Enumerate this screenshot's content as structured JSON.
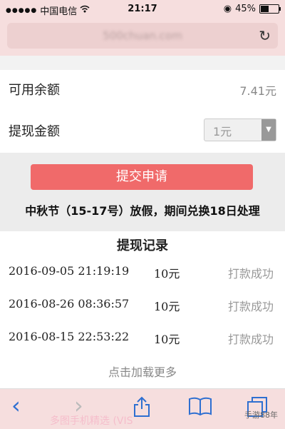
{
  "status": {
    "signal": "●●●●●",
    "carrier": "中国电信",
    "wifi_icon": "wifi-icon",
    "time": "21:17",
    "battery_pct": "45%",
    "battery_fill": 0.45
  },
  "browser": {
    "url": "500chuan.com"
  },
  "account": {
    "balance_label": "可用余额",
    "balance_value": "7.41元",
    "withdraw_label": "提现金额",
    "withdraw_selected": "1元"
  },
  "actions": {
    "submit_label": "提交申请",
    "notice": "中秋节（15-17号）放假，期间兑换18日处理"
  },
  "records": {
    "title": "提现记录",
    "rows": [
      {
        "date": "2016-09-05 21:19:19",
        "amount": "10元",
        "status": "打款成功"
      },
      {
        "date": "2016-08-26 08:36:57",
        "amount": "10元",
        "status": "打款成功"
      },
      {
        "date": "2016-08-15 22:53:22",
        "amount": "10元",
        "status": "打款成功"
      }
    ],
    "load_more": "点击加载更多"
  },
  "toolbar": {
    "back": "‹",
    "forward": "›",
    "share": "⇪",
    "bookmarks": "📖",
    "tabs": "❐",
    "watermark": "多图手机精选 (VIS",
    "wm_right": "手游88年"
  }
}
